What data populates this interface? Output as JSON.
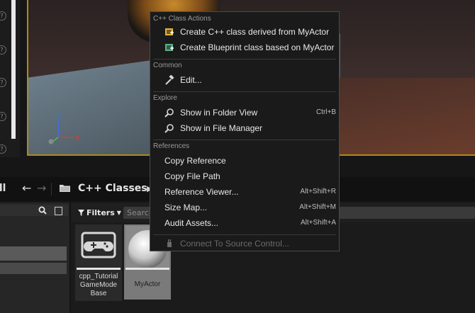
{
  "viewport": {
    "axis_labels": {
      "z": "Z",
      "x": "X",
      "y": "Y"
    }
  },
  "path_bar": {
    "all_label": "All",
    "back_arrow": "back-arrow-icon",
    "forward_arrow": "forward-arrow-icon",
    "folder_icon": "folder-icon",
    "path_label": "C++ Classes",
    "chevron": "chevron-right-icon"
  },
  "sources": {
    "search_icon": "search-icon",
    "view_icon": "view-options-icon"
  },
  "assets": {
    "filters_label": "Filters",
    "search_placeholder": "Search",
    "tiles": [
      {
        "label_lines": [
          "cpp_Tutorial",
          "GameMode",
          "Base"
        ],
        "icon": "gamemode-controller-icon"
      },
      {
        "label_lines": [
          "MyActor"
        ],
        "icon": "actor-sphere-icon"
      }
    ]
  },
  "context_menu": {
    "sections": [
      {
        "header": "C++ Class Actions",
        "items": [
          {
            "label": "Create C++ class derived from MyActor",
            "icon": "cpp-class-icon",
            "shortcut": "",
            "enabled": true
          },
          {
            "label": "Create Blueprint class based on MyActor",
            "icon": "blueprint-class-icon",
            "shortcut": "",
            "enabled": true
          }
        ]
      },
      {
        "header": "Common",
        "items": [
          {
            "label": "Edit...",
            "icon": "edit-hammer-icon",
            "shortcut": "",
            "enabled": true
          }
        ]
      },
      {
        "header": "Explore",
        "items": [
          {
            "label": "Show in Folder View",
            "icon": "magnifier-icon",
            "shortcut": "Ctrl+B",
            "enabled": true
          },
          {
            "label": "Show in File Manager",
            "icon": "magnifier-icon",
            "shortcut": "",
            "enabled": true
          }
        ]
      },
      {
        "header": "References",
        "items": [
          {
            "label": "Copy Reference",
            "icon": "",
            "shortcut": "",
            "enabled": true
          },
          {
            "label": "Copy File Path",
            "icon": "",
            "shortcut": "",
            "enabled": true
          },
          {
            "label": "Reference Viewer...",
            "icon": "",
            "shortcut": "Alt+Shift+R",
            "enabled": true
          },
          {
            "label": "Size Map...",
            "icon": "",
            "shortcut": "Alt+Shift+M",
            "enabled": true
          },
          {
            "label": "Audit Assets...",
            "icon": "",
            "shortcut": "Alt+Shift+A",
            "enabled": true
          }
        ]
      },
      {
        "header": "",
        "items": [
          {
            "label": "Connect To Source Control...",
            "icon": "source-control-plug-icon",
            "shortcut": "",
            "enabled": false
          }
        ]
      }
    ]
  },
  "colors": {
    "menu_background": "#1a1a1a",
    "viewport_border": "#b08a18",
    "accent_cpp_icon": "#e0b43c",
    "accent_blueprint_icon": "#5fb08a"
  }
}
